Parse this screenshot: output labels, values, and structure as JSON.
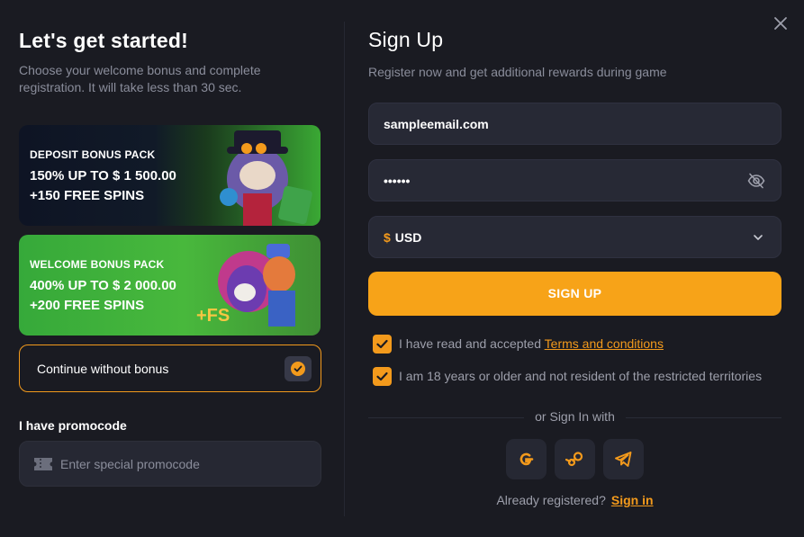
{
  "left": {
    "title": "Let's get started!",
    "subtitle": "Choose your welcome bonus and complete registration. It will take less than 30 sec.",
    "bonuses": [
      {
        "pack": "DEPOSIT BONUS PACK",
        "amount": "150% UP TO $ 1 500.00",
        "spins": "+150 FREE SPINS"
      },
      {
        "pack": "WELCOME BONUS PACK",
        "amount": "400% UP TO $ 2 000.00",
        "spins": "+200 FREE SPINS"
      }
    ],
    "continue_label": "Continue without bonus",
    "promo_label": "I have promocode",
    "promo_placeholder": "Enter special promocode"
  },
  "right": {
    "title": "Sign Up",
    "subtitle": "Register now and get additional rewards during game",
    "email_value": "sampleemail.com",
    "password_mask": "••••••",
    "currency_symbol": "$",
    "currency_value": "USD",
    "signup_label": "SIGN UP",
    "terms_prefix": "I have read and accepted ",
    "terms_link": "Terms and conditions",
    "age_text": "I am 18 years or older and not resident of the restricted territories",
    "or_text": "or Sign In with",
    "already_text": "Already registered?",
    "signin_link": "Sign in"
  },
  "icons": [
    "close-icon",
    "ticket-icon",
    "eye-slash-icon",
    "chevron-down-icon",
    "checkmark-icon",
    "google-icon",
    "steam-icon",
    "telegram-icon"
  ],
  "colors": {
    "accent": "#f7a318",
    "background": "#1a1b22",
    "field": "#272935",
    "muted_text": "#8a8d9b"
  }
}
